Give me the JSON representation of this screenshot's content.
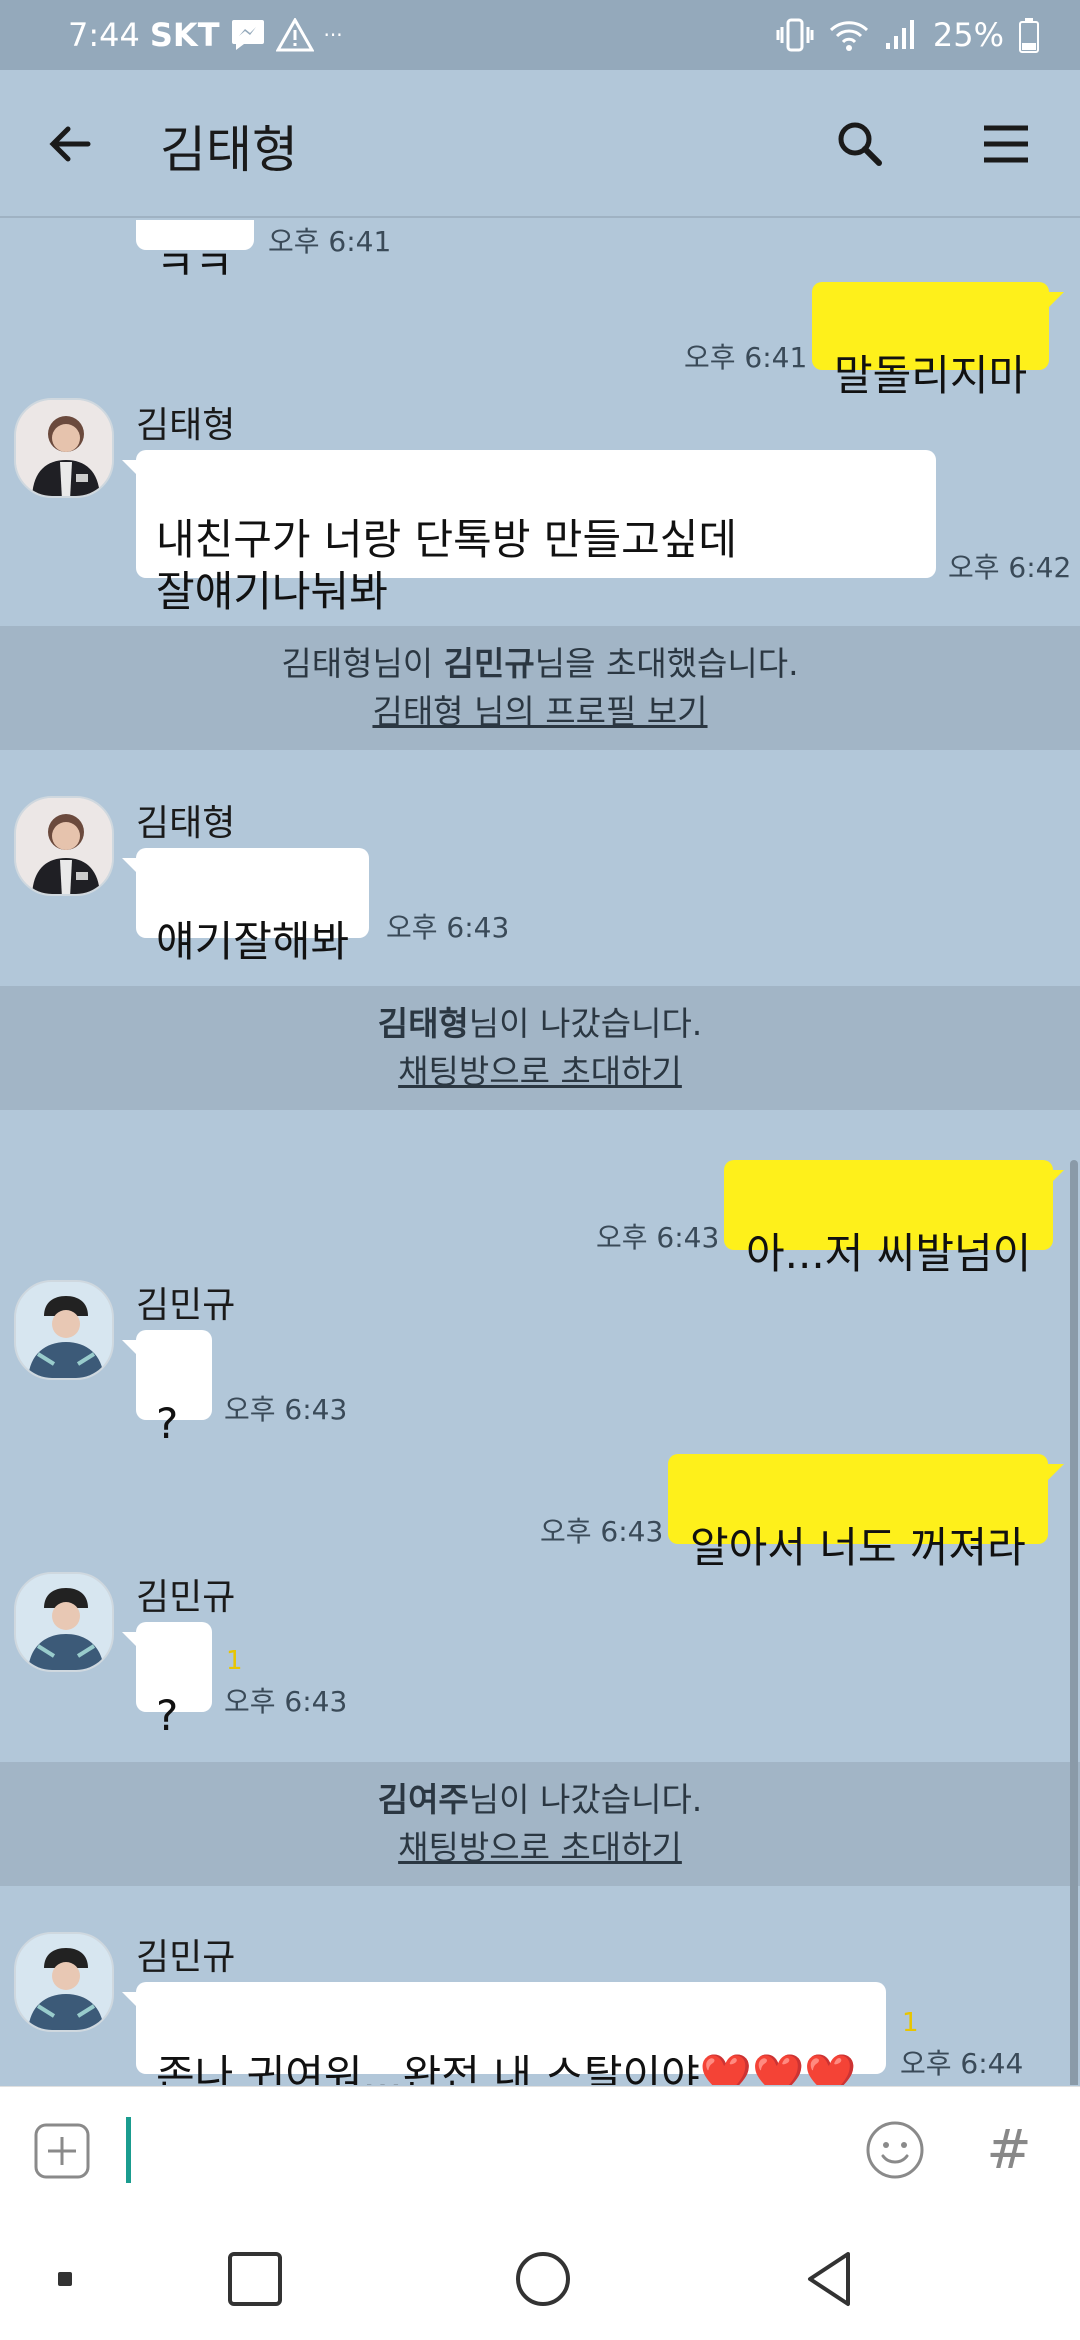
{
  "status_bar": {
    "time": "7:44",
    "carrier": "SKT",
    "extra": "···",
    "battery": "25%"
  },
  "header": {
    "title": "김태형"
  },
  "messages": [
    {
      "id": "m0",
      "side": "other",
      "text": "ㅋㅋ",
      "time": "오후 6:41"
    },
    {
      "id": "m1",
      "side": "me",
      "text": "말돌리지마",
      "time": "오후 6:41"
    },
    {
      "id": "m2",
      "side": "other",
      "sender": "김태형",
      "text": "내친구가 너랑 단톡방 만들고싶데\n잘얘기나눠봐",
      "time": "오후 6:42"
    },
    {
      "id": "m3",
      "side": "other",
      "sender": "김태형",
      "text": "얘기잘해봐",
      "time": "오후 6:43"
    },
    {
      "id": "m4",
      "side": "me",
      "text": "아...저 씨발넘이",
      "time": "오후 6:43"
    },
    {
      "id": "m5",
      "side": "other",
      "sender": "김민규",
      "text": "?",
      "time": "오후 6:43"
    },
    {
      "id": "m6",
      "side": "me",
      "text": "알아서 너도 꺼져라",
      "time": "오후 6:43"
    },
    {
      "id": "m7",
      "side": "other",
      "sender": "김민규",
      "text": "?",
      "time": "오후 6:43",
      "unread": "1"
    },
    {
      "id": "m8",
      "side": "other",
      "sender": "김민규",
      "text": "존나 귀여워...완전 내 스탈이야❤️❤️❤️",
      "time": "오후 6:44",
      "unread": "1"
    }
  ],
  "notices": [
    {
      "prefix": "김태형님이 ",
      "bold": "김민규",
      "suffix": "님을 초대했습니다.",
      "link": "김태형 님의 프로필 보기"
    },
    {
      "prefix": "",
      "bold": "김태형",
      "suffix": "님이 나갔습니다.",
      "link": "채팅방으로 초대하기"
    },
    {
      "prefix": "",
      "bold": "김여주",
      "suffix": "님이 나갔습니다.",
      "link": "채팅방으로 초대하기"
    }
  ],
  "input": {
    "hash_symbol": "#"
  },
  "colors": {
    "chat_background": "#b2c7d9",
    "my_bubble": "#fef01b",
    "other_bubble": "#ffffff",
    "notice_background": "#a2b5c6",
    "unread_count": "#e8c500"
  },
  "icons": {
    "back": "arrow-left-icon",
    "search": "search-icon",
    "menu": "hamburger-menu-icon",
    "attach": "plus-icon",
    "emoji": "smiley-icon"
  }
}
